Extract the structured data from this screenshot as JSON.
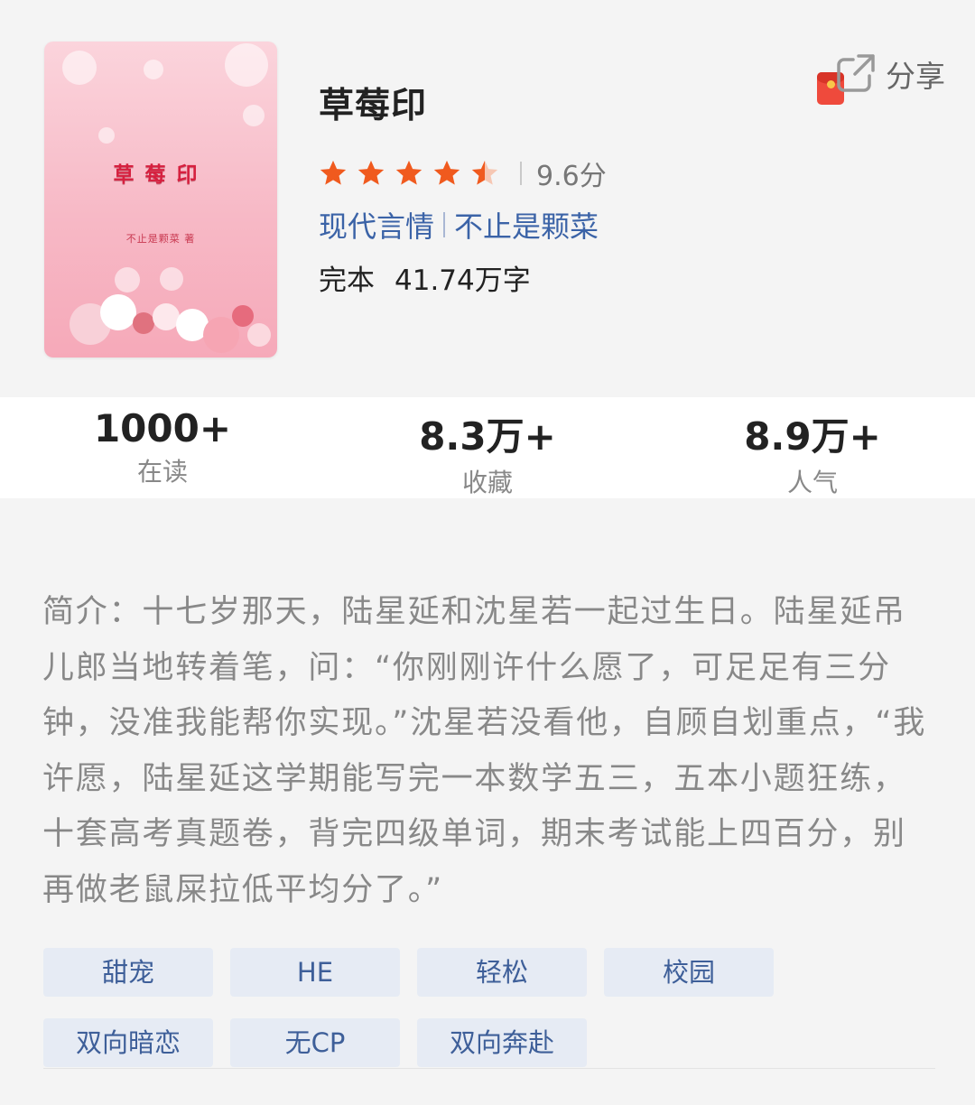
{
  "book": {
    "cover_title": "草莓印",
    "cover_author": "不止是颗菜 著",
    "title": "草莓印",
    "rating": 4.5,
    "score": "9.6分",
    "category": "现代言情",
    "author": "不止是颗菜",
    "status": "完本",
    "word_count": "41.74万字"
  },
  "share": {
    "label": "分享"
  },
  "stats": [
    {
      "value": "1000+",
      "label": "在读"
    },
    {
      "value": "8.3万+",
      "label": "收藏"
    },
    {
      "value": "8.9万+",
      "label": "人气"
    }
  ],
  "intro": "简介：十七岁那天，陆星延和沈星若一起过生日。陆星延吊儿郎当地转着笔，问：“你刚刚许什么愿了，可足足有三分钟，没准我能帮你实现。”沈星若没看他，自顾自划重点，“我许愿，陆星延这学期能写完一本数学五三，五本小题狂练，十套高考真题卷，背完四级单词，期末考试能上四百分，别再做老鼠屎拉低平均分了。”",
  "tags": [
    "甜宠",
    "HE",
    "轻松",
    "校园",
    "双向暗恋",
    "无CP",
    "双向奔赴"
  ],
  "colors": {
    "accent_blue": "#3b63a7",
    "star_orange": "#f05a1e",
    "tag_bg": "#e6ebf4"
  }
}
